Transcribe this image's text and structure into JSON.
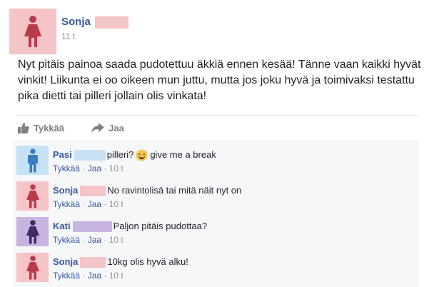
{
  "colors": {
    "link": "#365899",
    "muted": "#90949c",
    "female_avatar_bg": "#f4c4c6",
    "male_avatar_bg": "#c7e2f5",
    "purple_avatar_bg": "#c8b4e0",
    "comments_bg": "#f6f7f9"
  },
  "post": {
    "author": "Sonja",
    "avatar_icon": "female-person-icon",
    "time": "11 t",
    "text": "Nyt pitäis painoa saada pudotettuu äkkiä ennen kesää! Tänne vaan kaikki hyvät vinkit! Liikunta ei oo oikeen mun juttu, mutta jos joku hyvä ja toimivaksi testattu pika dietti tai pilleri jollain olis vinkata!"
  },
  "actions": {
    "like_label": "Tykkää",
    "like_icon": "thumbs-up-icon",
    "share_label": "Jaa",
    "share_icon": "share-arrow-icon"
  },
  "comments": [
    {
      "author": "Pasi",
      "avatar_icon": "male-person-icon",
      "text_before_emoji": "pilleri?",
      "emoji_icon": "grinning-sweat-emoji-icon",
      "text": "give me a break",
      "like_label": "Tykkää",
      "reply_label": "Jaa",
      "time": "10 t"
    },
    {
      "author": "Sonja",
      "avatar_icon": "female-person-icon",
      "text": "No ravintolisä tai mitä näit nyt on",
      "like_label": "Tykkää",
      "reply_label": "Jaa",
      "time": "10 t"
    },
    {
      "author": "Kati",
      "avatar_icon": "female-person-icon",
      "text": "Paljon pitäis pudottaa?",
      "like_label": "Tykkää",
      "reply_label": "Jaa",
      "time": "10 t"
    },
    {
      "author": "Sonja",
      "avatar_icon": "female-person-icon",
      "text": "10kg olis hyvä alku!",
      "like_label": "Tykkää",
      "reply_label": "Jaa",
      "time": "10 t"
    }
  ],
  "separator": "·"
}
